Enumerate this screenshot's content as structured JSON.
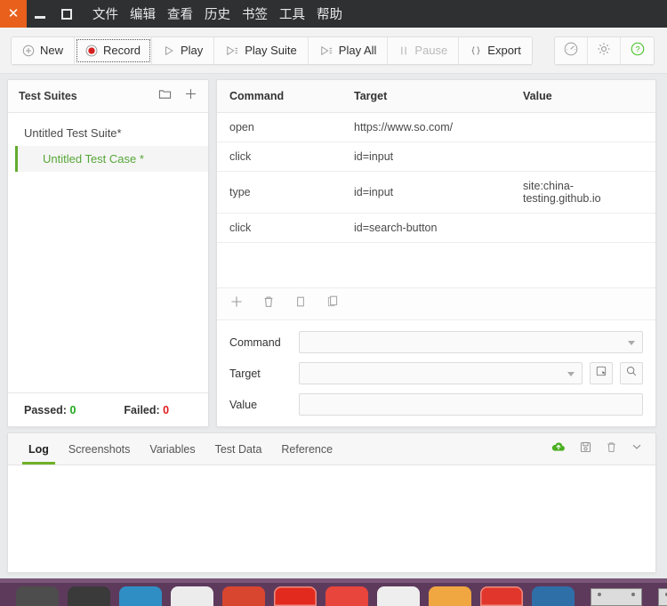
{
  "window": {
    "controls": {
      "close": "✕",
      "minimize": "—",
      "maximize": "□"
    },
    "menu": [
      "文件",
      "编辑",
      "查看",
      "历史",
      "书签",
      "工具",
      "帮助"
    ]
  },
  "toolbar": {
    "buttons": [
      {
        "label": "New",
        "icon": "plus-circle-icon",
        "state": "enabled"
      },
      {
        "label": "Record",
        "icon": "record-dot-icon",
        "state": "focused"
      },
      {
        "label": "Play",
        "icon": "play-triangle-icon",
        "state": "enabled"
      },
      {
        "label": "Play Suite",
        "icon": "play-suite-icon",
        "state": "enabled"
      },
      {
        "label": "Play All",
        "icon": "play-all-icon",
        "state": "enabled"
      },
      {
        "label": "Pause",
        "icon": "pause-icon",
        "state": "disabled"
      },
      {
        "label": "Export",
        "icon": "braces-icon",
        "state": "enabled"
      }
    ],
    "right_buttons": [
      {
        "icon": "speedometer-icon",
        "name": "speed-settings-button"
      },
      {
        "icon": "gear-icon",
        "name": "settings-button"
      },
      {
        "icon": "question-circle-icon",
        "name": "help-button"
      }
    ],
    "accent_green": "#6eb127",
    "record_red": "#d61f1f"
  },
  "sidebar": {
    "title": "Test Suites",
    "icons": [
      {
        "name": "new-folder-icon",
        "glyph": "folder"
      },
      {
        "name": "add-icon",
        "glyph": "plus"
      }
    ],
    "suite": "Untitled Test Suite*",
    "test_case": "Untitled Test Case *",
    "footer": {
      "passed_label": "Passed:",
      "passed_value": "0",
      "failed_label": "Failed:",
      "failed_value": "0",
      "passed_color": "#1faa1f",
      "failed_color": "#e01b1b"
    }
  },
  "editor": {
    "columns": [
      "Command",
      "Target",
      "Value"
    ],
    "rows": [
      {
        "command": "open",
        "target": "https://www.so.com/",
        "value": ""
      },
      {
        "command": "click",
        "target": "id=input",
        "value": ""
      },
      {
        "command": "type",
        "target": "id=input",
        "value": "site:china-testing.github.io"
      },
      {
        "command": "click",
        "target": "id=search-button",
        "value": ""
      }
    ],
    "row_tools": [
      {
        "name": "add-row-icon",
        "glyph": "plus"
      },
      {
        "name": "delete-row-icon",
        "glyph": "trash"
      },
      {
        "name": "copy-row-icon",
        "glyph": "copy"
      },
      {
        "name": "paste-row-icon",
        "glyph": "paste"
      }
    ],
    "form": {
      "command_label": "Command",
      "command_value": "",
      "target_label": "Target",
      "target_value": "",
      "value_label": "Value",
      "value_value": "",
      "select_target_icon": "select-target-icon",
      "find_target_icon": "find-target-icon"
    }
  },
  "log": {
    "tabs": [
      {
        "label": "Log",
        "active": true
      },
      {
        "label": "Screenshots",
        "active": false
      },
      {
        "label": "Variables",
        "active": false
      },
      {
        "label": "Test Data",
        "active": false
      },
      {
        "label": "Reference",
        "active": false
      }
    ],
    "icons": [
      {
        "name": "cloud-upload-icon",
        "color": "#4caf22"
      },
      {
        "name": "save-icon",
        "color": "#8a8a8a"
      },
      {
        "name": "clear-log-icon",
        "color": "#8a8a8a"
      },
      {
        "name": "chevron-down-icon",
        "color": "#8a8a8a"
      }
    ],
    "content": ""
  },
  "taskbar": {
    "items": [
      {
        "name": "taskbar-icon-1",
        "color": "#4d4d4d"
      },
      {
        "name": "taskbar-icon-2",
        "color": "#3a3a3a"
      },
      {
        "name": "taskbar-icon-3",
        "color": "#2f8fc4"
      },
      {
        "name": "taskbar-icon-4",
        "color": "#ececec"
      },
      {
        "name": "taskbar-icon-5",
        "color": "#d9462f"
      },
      {
        "name": "taskbar-icon-6",
        "color": "#e22a1f",
        "framed": true
      },
      {
        "name": "taskbar-icon-7",
        "color": "#e8453c"
      },
      {
        "name": "taskbar-icon-8",
        "color": "#eeeeee"
      },
      {
        "name": "taskbar-icon-9",
        "color": "#f0a742"
      },
      {
        "name": "taskbar-icon-10",
        "color": "#e0362c",
        "framed": true
      },
      {
        "name": "taskbar-icon-11",
        "color": "#2f6fa8"
      }
    ]
  }
}
